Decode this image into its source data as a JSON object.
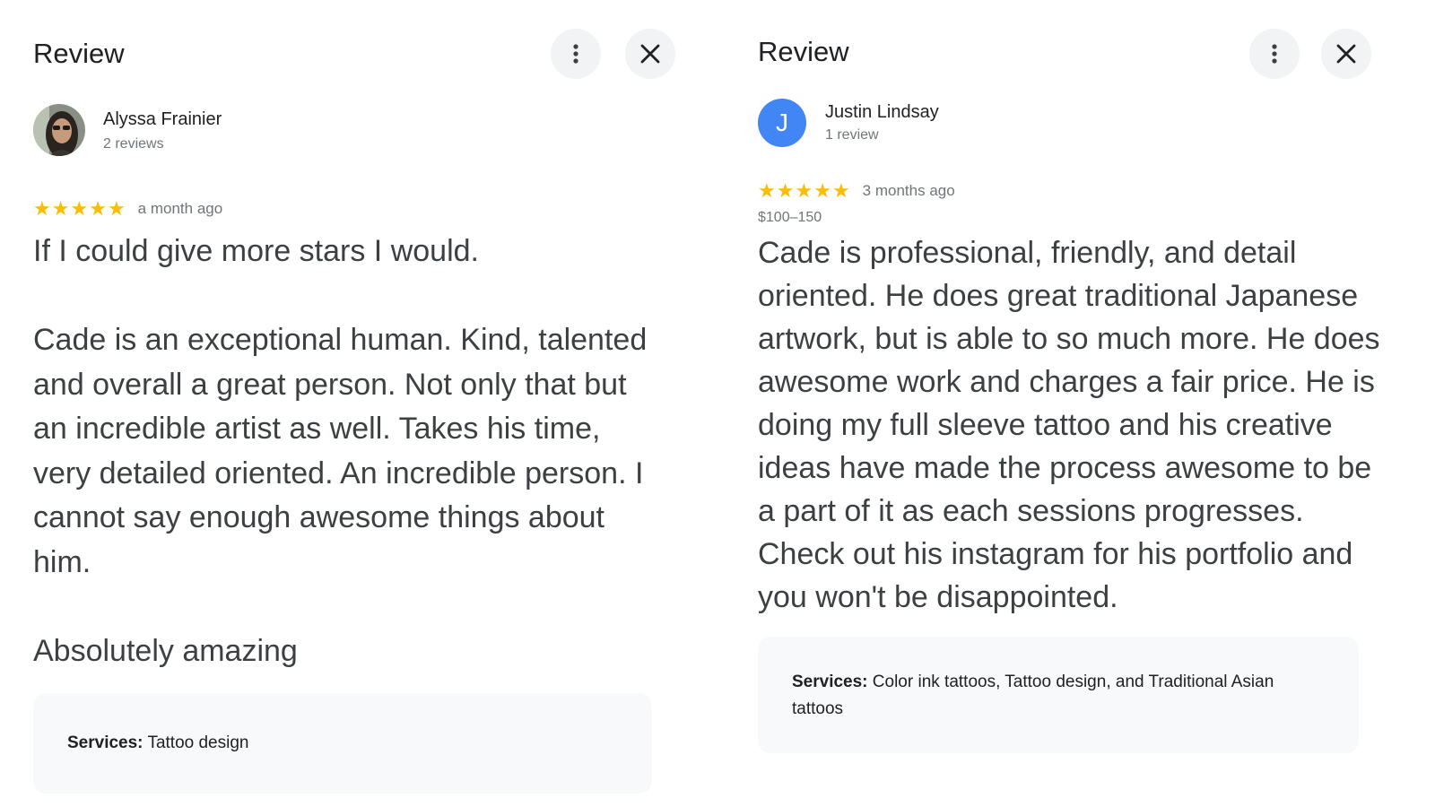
{
  "left_review": {
    "header_title": "Review",
    "author_name": "Alyssa Frainier",
    "author_review_count": "2 reviews",
    "rating": 5,
    "time_ago": "a month ago",
    "text": "If I could give more stars I would.\n\nCade is an exceptional human. Kind, talented and overall a great person. Not only that but an incredible artist as well. Takes his time, very detailed oriented. An incredible person. I cannot say enough awesome things about him.\n\nAbsolutely amazing",
    "services_label": "Services:",
    "services_value": " Tattoo design"
  },
  "right_review": {
    "header_title": "Review",
    "author_initial": "J",
    "author_name": "Justin Lindsay",
    "author_review_count": "1 review",
    "rating": 5,
    "time_ago": "3 months ago",
    "price": "$100–150",
    "text": "Cade is professional, friendly, and detail oriented. He does great traditional Japanese artwork, but is able to so much more. He does awesome work and charges a fair price. He is doing my full sleeve tattoo and his creative ideas have made the process awesome to be a part of it as each sessions progresses. Check out his instagram for his portfolio and you won't be disappointed.",
    "services_label": "Services:",
    "services_value": " Color ink tattoos, Tattoo design, and Traditional Asian tattoos"
  },
  "icons": {
    "more": "more-vert-icon",
    "close": "close-icon",
    "star": "star-icon"
  },
  "colors": {
    "star": "#fbbc04",
    "avatar_initial_bg": "#4285f4",
    "services_bg": "#f8f9fa",
    "icon_button_bg": "#f1f3f4",
    "muted_text": "#70757a"
  }
}
